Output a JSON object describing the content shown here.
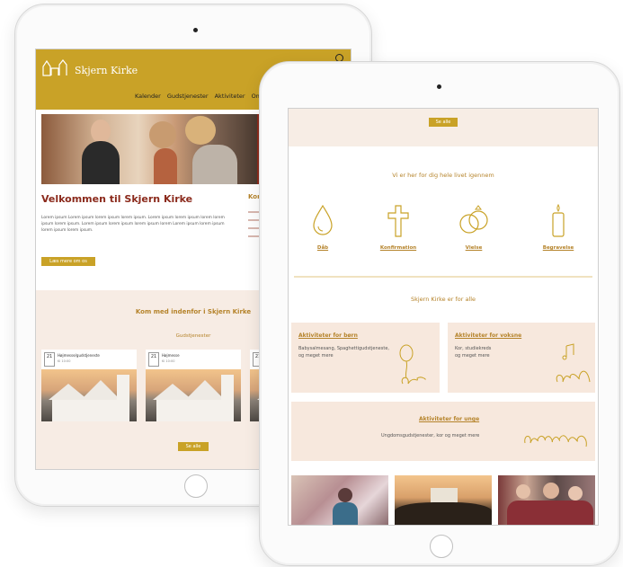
{
  "back_tablet": {
    "brand": "Skjern Kirke",
    "nav": [
      "Kalender",
      "Gudstjenester",
      "Aktiviteter",
      "Om kirken"
    ],
    "welcome_title": "Velkommen til Skjern Kirke",
    "lorem": "Lorem ipsum Lorem ipsum lorem ipsum lorem ipsum. Lorem ipsum lorem ipsum lorem lorem ipsum lorem ipsum. Lorem ipsum lorem ipsum lorem ipsum lorem Lorem ipsum lorem ipsum lorem ipsum lorem ipsum.",
    "welcome_button": "Læs mere om os",
    "side_title": "Kom",
    "calendar_title": "Kom med indenfor i Skjern Kirke",
    "calendar_subtitle": "Gudstjenester",
    "events": [
      {
        "day": "21",
        "title": "Højmesse/gudstjeneste",
        "sub": "Kl 10:00"
      },
      {
        "day": "21",
        "title": "Højmesse",
        "sub": "Kl 10:00"
      },
      {
        "day": "21",
        "title": "",
        "sub": ""
      }
    ],
    "more_button": "Se alle"
  },
  "front_tablet": {
    "top_button": "Se alle",
    "section1_title": "Vi er her for dig hele livet igennem",
    "life_events": [
      {
        "label": "Dåb",
        "icon": "drop-icon"
      },
      {
        "label": "Konfirmation",
        "icon": "cross-icon"
      },
      {
        "label": "Vielse",
        "icon": "rings-icon"
      },
      {
        "label": "Begravelse",
        "icon": "candle-icon"
      }
    ],
    "section2_title": "Skjern Kirke er for alle",
    "boxes": [
      {
        "title": "Aktiviteter for børn",
        "desc": [
          "Babysalmesang, Spaghettigudstjeneste,",
          "og meget mere"
        ]
      },
      {
        "title": "Aktiviteter for voksne",
        "desc": [
          "Kor, studiekreds",
          "og meget mere"
        ]
      },
      {
        "title": "Aktiviteter for unge",
        "desc": [
          "Ungdomsgudstjenester, kor og meget mere"
        ]
      }
    ]
  },
  "colors": {
    "gold": "#c9a227",
    "rust": "#8b2a1c",
    "beige": "#f7e8dd"
  }
}
